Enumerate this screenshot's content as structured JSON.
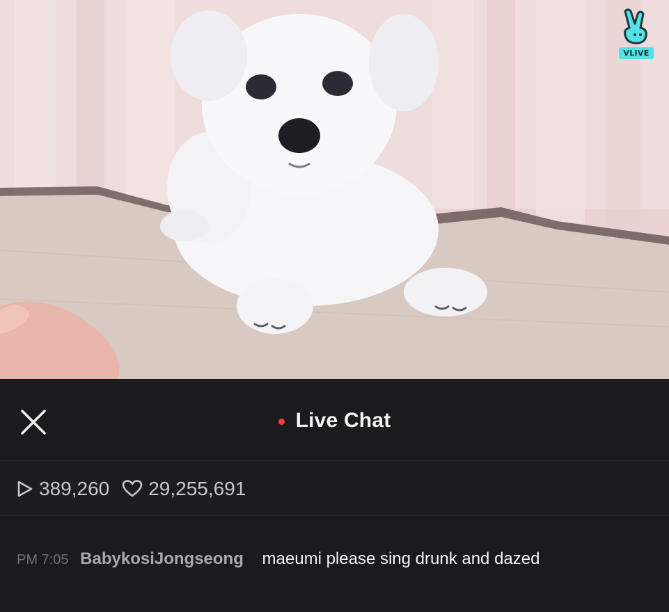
{
  "brand": {
    "logo_text": "VLIVE",
    "accent": "#54e1e6"
  },
  "header": {
    "close_icon": "close-icon",
    "live_dot_color": "#ff3b3b",
    "title": "Live Chat"
  },
  "stats": {
    "plays": "389,260",
    "hearts": "29,255,691"
  },
  "chat": {
    "messages": [
      {
        "time": "PM 7:05",
        "user": "BabykosiJongseong",
        "text": "maeumi please sing drunk and dazed"
      }
    ]
  }
}
